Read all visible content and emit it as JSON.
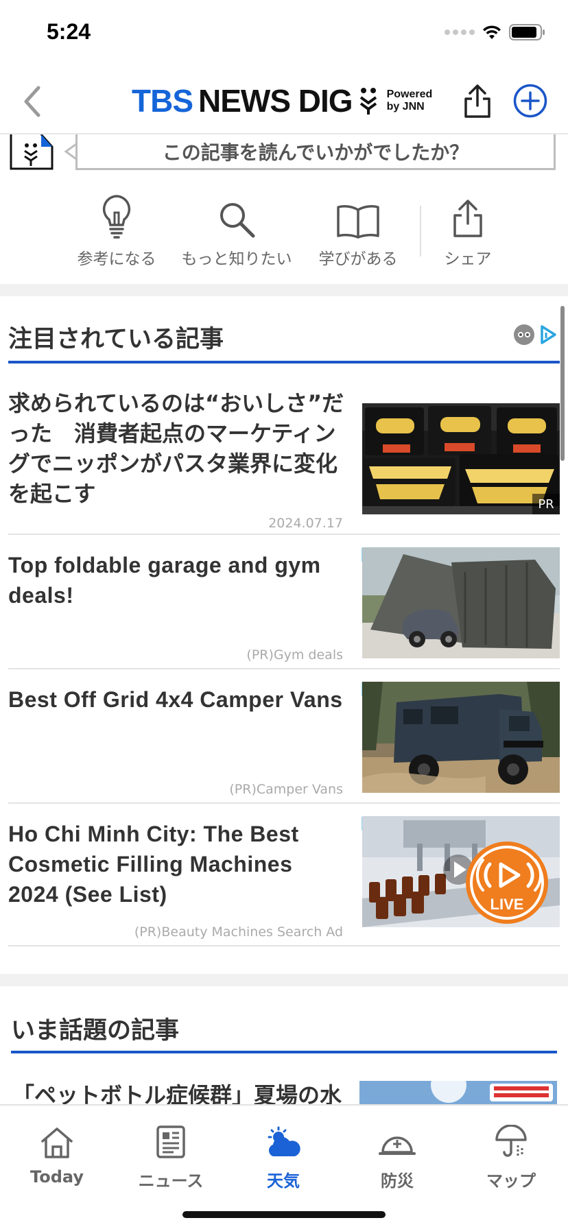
{
  "status": {
    "time": "5:24"
  },
  "header": {
    "logo_main": "TBS",
    "logo_rest": "NEWS DIG",
    "powered_line1": "Powered",
    "powered_line2": "by JNN"
  },
  "feedback": {
    "question": "この記事を読んでいかがでしたか？",
    "reactions": [
      {
        "label": "参考になる",
        "icon": "lightbulb-icon"
      },
      {
        "label": "もっと知りたい",
        "icon": "search-icon"
      },
      {
        "label": "学びがある",
        "icon": "book-icon"
      },
      {
        "label": "シェア",
        "icon": "share-icon"
      }
    ]
  },
  "featured": {
    "title": "注目されている記事",
    "articles": [
      {
        "title": "求められているのは“おいしさ”だった　消費者起点のマーケティングでニッポンがパスタ業界に変化を起こす",
        "meta": "2024.07.17",
        "pr_tag": "PR"
      },
      {
        "title": "Top foldable garage and gym deals!",
        "meta": "(PR)Gym deals"
      },
      {
        "title": "Best Off Grid 4x4 Camper Vans",
        "meta": "(PR)Camper Vans"
      },
      {
        "title": "Ho Chi Minh City: The Best Cosmetic Filling Machines 2024 (See List)",
        "meta": "(PR)Beauty Machines Search Ad"
      }
    ],
    "live_label": "LIVE"
  },
  "trending": {
    "title": "いま話題の記事",
    "first_article_title": "「ペットボトル症候群」夏場の水"
  },
  "tabbar": {
    "tabs": [
      {
        "label": "Today",
        "icon": "home-icon"
      },
      {
        "label": "ニュース",
        "icon": "newspaper-icon"
      },
      {
        "label": "天気",
        "icon": "weather-icon",
        "active": true
      },
      {
        "label": "防災",
        "icon": "helmet-icon"
      },
      {
        "label": "マップ",
        "icon": "umbrella-map-icon"
      }
    ]
  },
  "colors": {
    "accent": "#1a62d6",
    "brand_blue": "#1565d8",
    "live_orange": "#f07d1e"
  }
}
